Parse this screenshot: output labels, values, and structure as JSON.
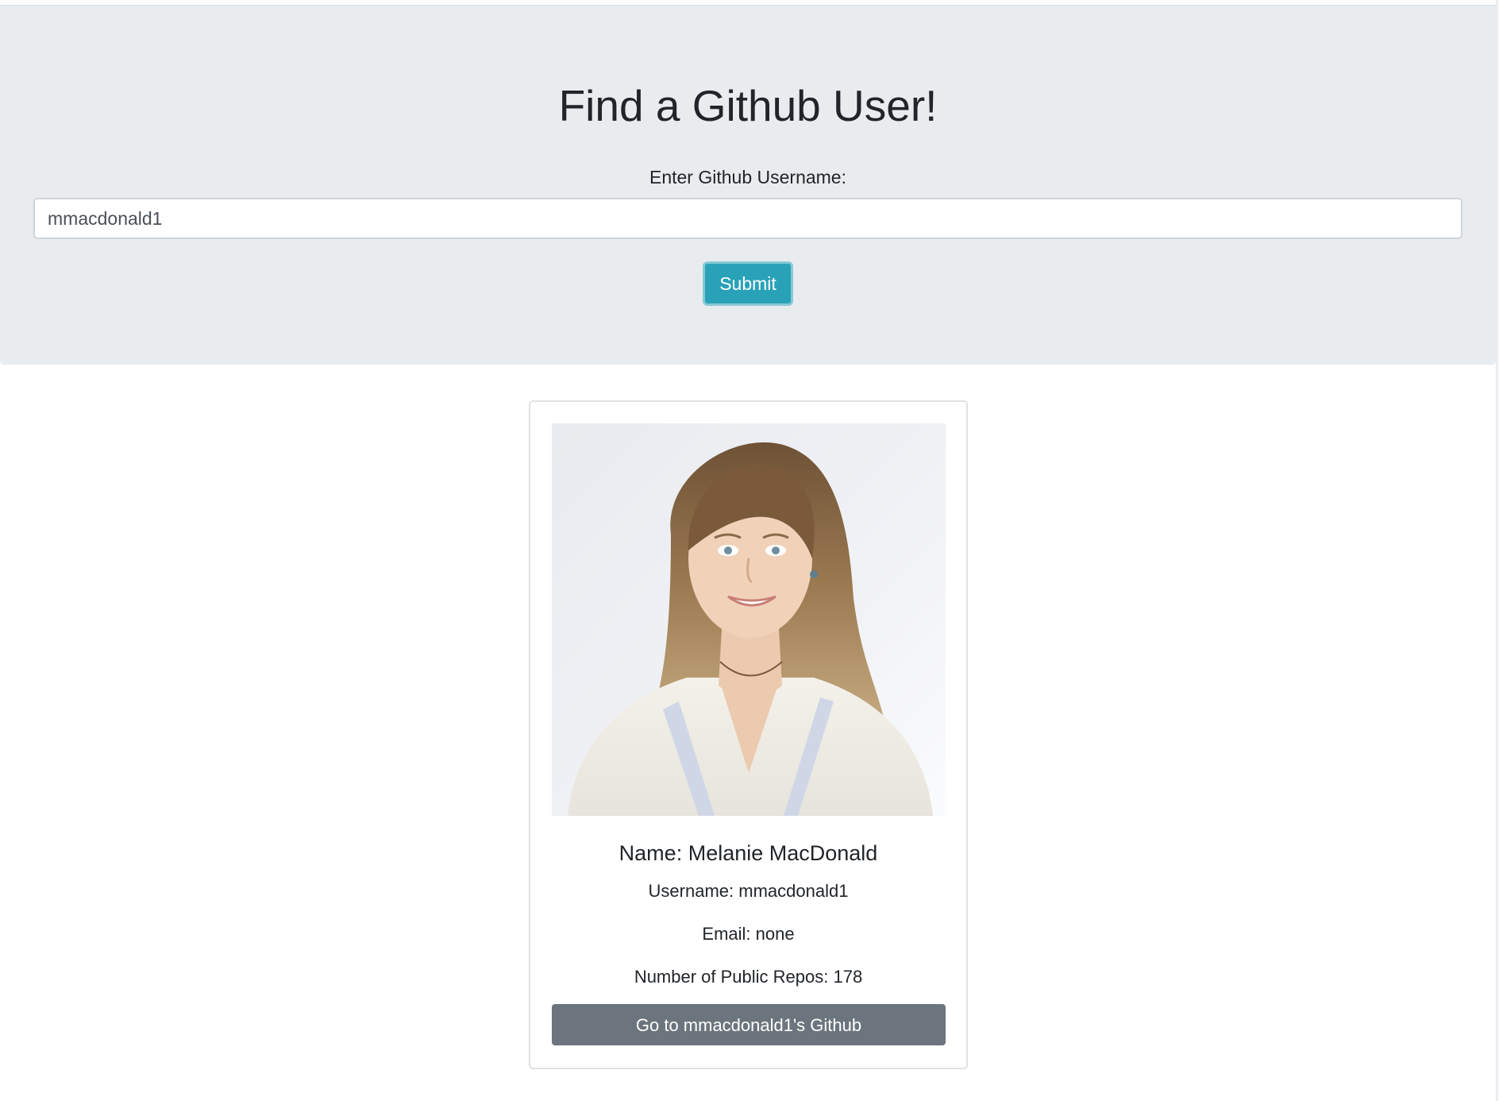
{
  "header": {
    "title": "Find a Github User!",
    "input_label": "Enter Github Username:",
    "username_value": "mmacdonald1",
    "submit_label": "Submit"
  },
  "profile": {
    "avatar": "profile-photo",
    "name_line": "Name: Melanie MacDonald",
    "username_line": "Username: mmacdonald1",
    "email_line": "Email: none",
    "repos_line": "Number of Public Repos: 178",
    "github_button_label": "Go to mmacdonald1's Github"
  },
  "colors": {
    "jumbotron_bg": "#e9ecef",
    "submit_button": "#29a2b8",
    "github_button": "#6c757d",
    "text": "#212529"
  }
}
